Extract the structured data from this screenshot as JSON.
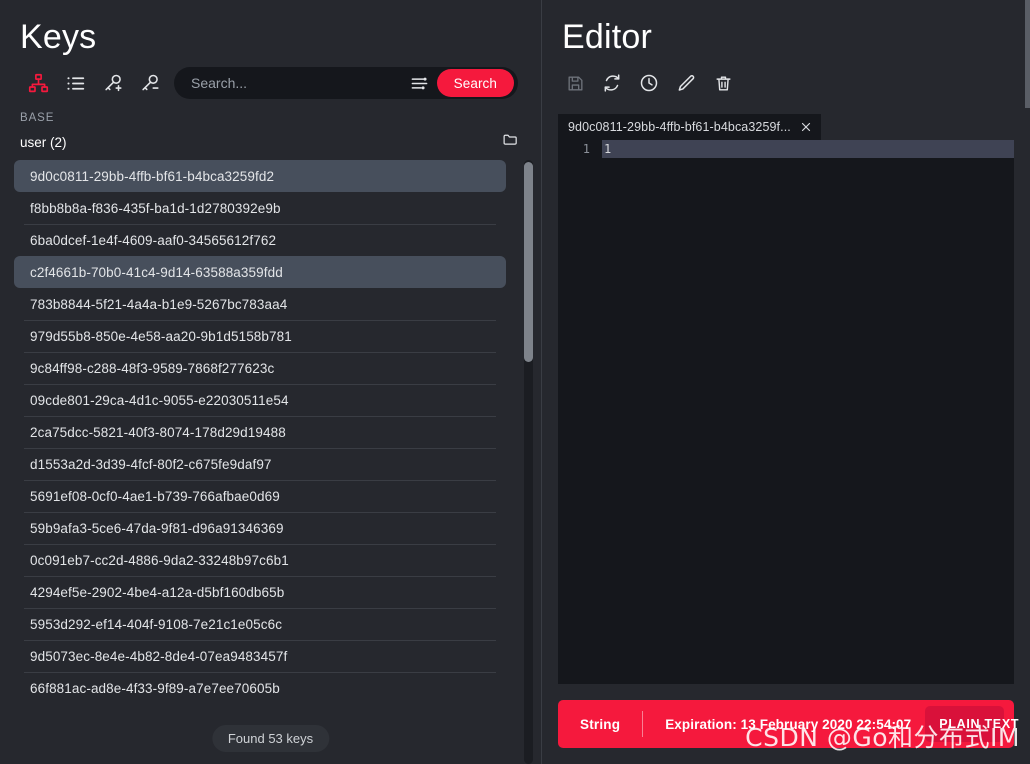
{
  "keys_panel": {
    "title": "Keys",
    "toolbar_icons": [
      {
        "name": "tree-view-icon",
        "active": true
      },
      {
        "name": "list-view-icon",
        "active": false
      },
      {
        "name": "add-key-icon",
        "active": false
      },
      {
        "name": "remove-key-icon",
        "active": false
      }
    ],
    "search": {
      "placeholder": "Search...",
      "value": "",
      "filter_icon": "filter-sliders-icon",
      "button_label": "Search"
    },
    "section_label": "BASE",
    "group": {
      "name": "user (2)",
      "folder_icon": "folder-icon"
    },
    "keys": [
      {
        "id": "9d0c0811-29bb-4ffb-bf61-b4bca3259fd2",
        "selected": true
      },
      {
        "id": "f8bb8b8a-f836-435f-ba1d-1d2780392e9b",
        "selected": false
      },
      {
        "id": "6ba0dcef-1e4f-4609-aaf0-34565612f762",
        "selected": false
      },
      {
        "id": "c2f4661b-70b0-41c4-9d14-63588a359fdd",
        "selected": true
      },
      {
        "id": "783b8844-5f21-4a4a-b1e9-5267bc783aa4",
        "selected": false
      },
      {
        "id": "979d55b8-850e-4e58-aa20-9b1d5158b781",
        "selected": false
      },
      {
        "id": "9c84ff98-c288-48f3-9589-7868f277623c",
        "selected": false
      },
      {
        "id": "09cde801-29ca-4d1c-9055-e22030511e54",
        "selected": false
      },
      {
        "id": "2ca75dcc-5821-40f3-8074-178d29d19488",
        "selected": false
      },
      {
        "id": "d1553a2d-3d39-4fcf-80f2-c675fe9daf97",
        "selected": false
      },
      {
        "id": "5691ef08-0cf0-4ae1-b739-766afbae0d69",
        "selected": false
      },
      {
        "id": "59b9afa3-5ce6-47da-9f81-d96a91346369",
        "selected": false
      },
      {
        "id": "0c091eb7-cc2d-4886-9da2-33248b97c6b1",
        "selected": false
      },
      {
        "id": "4294ef5e-2902-4be4-a12a-d5bf160db65b",
        "selected": false
      },
      {
        "id": "5953d292-ef14-404f-9108-7e21c1e05c6c",
        "selected": false
      },
      {
        "id": "9d5073ec-8e4e-4b82-8de4-07ea9483457f",
        "selected": false
      },
      {
        "id": "66f881ac-ad8e-4f33-9f89-a7e7ee70605b",
        "selected": false
      }
    ],
    "found_badge": "Found 53 keys"
  },
  "editor_panel": {
    "title": "Editor",
    "toolbar_icons": [
      {
        "name": "save-icon",
        "label": "Save",
        "disabled": true
      },
      {
        "name": "refresh-icon",
        "label": "Refresh",
        "disabled": false
      },
      {
        "name": "ttl-clock-icon",
        "label": "TTL",
        "disabled": false
      },
      {
        "name": "edit-pencil-icon",
        "label": "Edit",
        "disabled": false
      },
      {
        "name": "delete-trash-icon",
        "label": "Delete",
        "disabled": false
      }
    ],
    "tab": {
      "label": "9d0c0811-29bb-4ffb-bf61-b4bca3259f...",
      "close_icon": "close-icon"
    },
    "code": {
      "lines": [
        {
          "number": "1",
          "text": "1",
          "active": true
        }
      ]
    },
    "status": {
      "type": "String",
      "expiration": "Expiration: 13 February 2020 22:54:07",
      "format": "PLAIN TEXT",
      "format_chevron": "chevron-down-icon"
    }
  },
  "watermark": "CSDN @Go和分布式IM",
  "colors": {
    "accent_red": "#f5193d",
    "panel_bg": "#26282e",
    "code_bg": "#15171c",
    "selected_row": "#474f5c",
    "divider": "#3a3d44"
  }
}
